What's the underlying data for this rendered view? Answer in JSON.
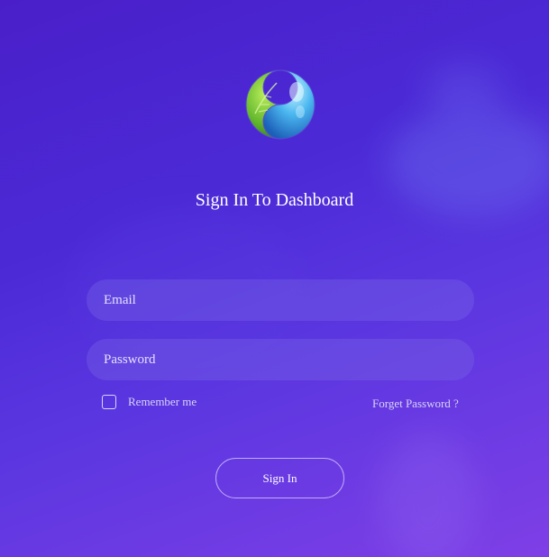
{
  "title": "Sign In To Dashboard",
  "email": {
    "placeholder": "Email",
    "value": ""
  },
  "password": {
    "placeholder": "Password",
    "value": ""
  },
  "remember": {
    "label": "Remember me",
    "checked": false
  },
  "forgot_label": "Forget Password ?",
  "signin_label": "Sign In",
  "icons": {
    "logo": "leaf-water-yin-yang-logo"
  },
  "colors": {
    "background_top": "#4a1fc9",
    "background_bottom": "#7f3fe6",
    "text": "#ffffff",
    "field_fill": "rgba(120,100,230,0.38)"
  }
}
